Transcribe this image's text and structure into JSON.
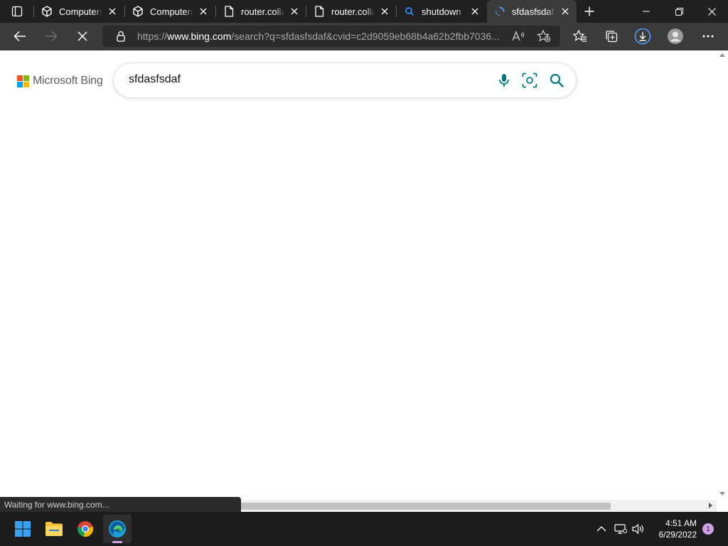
{
  "browser": {
    "tabs": [
      {
        "title": "Computerm",
        "icon": "cube-icon",
        "active": false
      },
      {
        "title": "Computerm",
        "icon": "cube-icon",
        "active": false
      },
      {
        "title": "router.colla",
        "icon": "document-icon",
        "active": false
      },
      {
        "title": "router.colla",
        "icon": "document-icon",
        "active": false
      },
      {
        "title": "shutdown -",
        "icon": "search-icon",
        "active": false
      },
      {
        "title": "sfdasfsdaf -",
        "icon": "loading-spinner-icon",
        "active": true
      }
    ],
    "address": {
      "scheme": "https://",
      "host": "www.bing.com",
      "path": "/search?q=sfdasfsdaf&cvid=c2d9059eb68b4a62b2fbb7036..."
    },
    "status_text": "Waiting for www.bing.com..."
  },
  "page": {
    "logo_text": "Microsoft Bing",
    "search_query": "sfdasfsdaf"
  },
  "taskbar": {
    "apps": [
      "windows-start",
      "file-explorer",
      "chrome",
      "edge"
    ],
    "time": "4:51 AM",
    "date": "6/29/2022",
    "notification_count": "1"
  },
  "colors": {
    "accent": "#1976d2",
    "bing_teal": "#007c80",
    "download_blue": "#4ea0ff",
    "notification": "#d1a1e8"
  }
}
